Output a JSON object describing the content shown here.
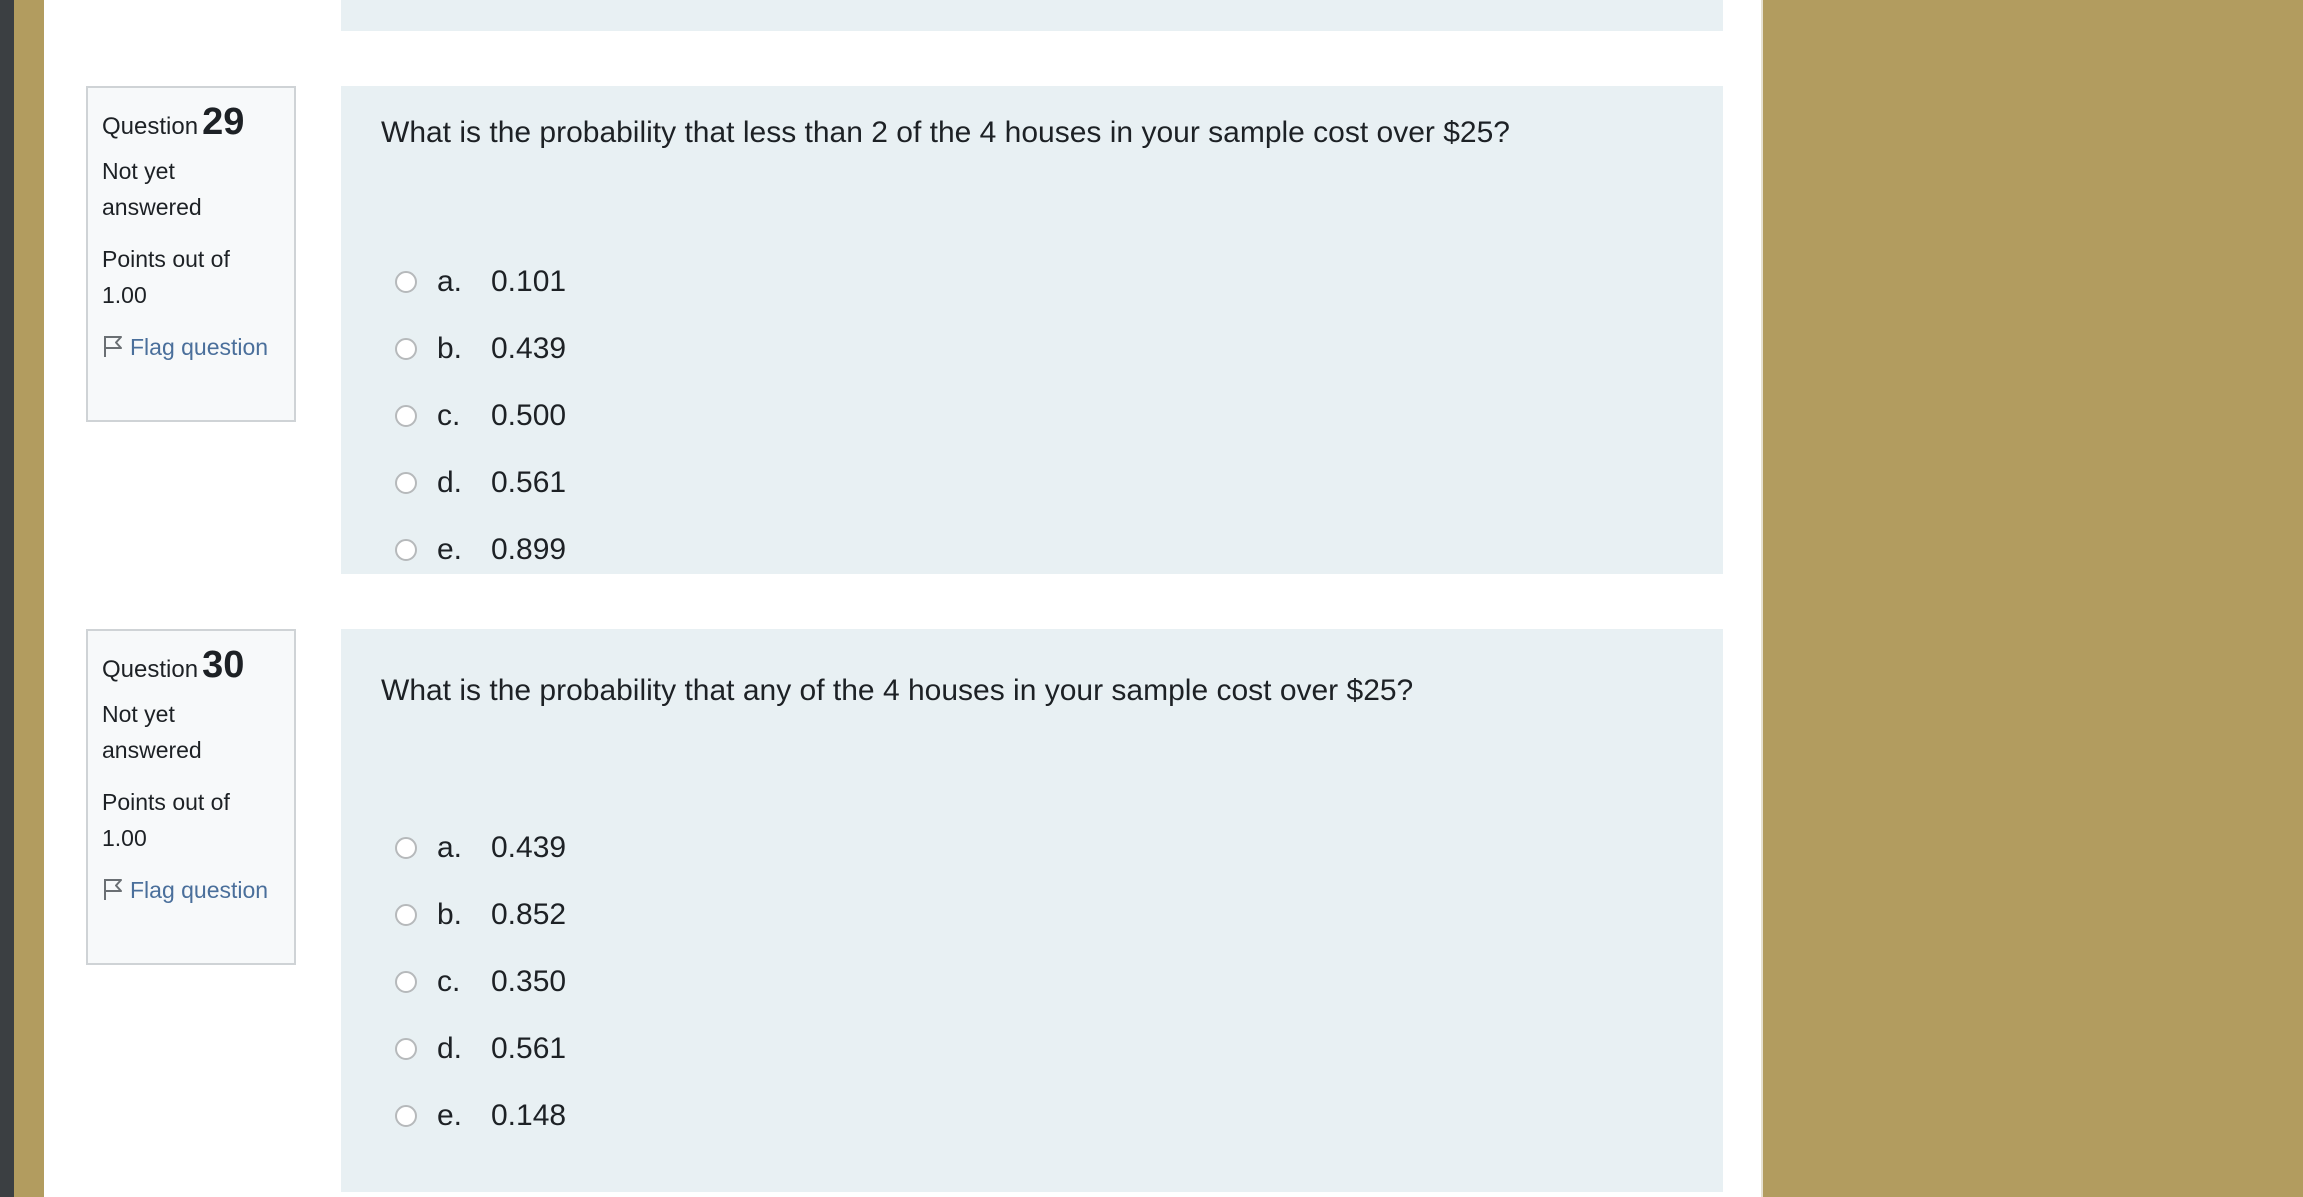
{
  "questions": [
    {
      "prefix": "Question",
      "number": "29",
      "state": "Not yet answered",
      "grade": "Points out of 1.00",
      "flag": "Flag question",
      "text": "What is the probability that less than 2 of the 4 houses in your sample cost over $25?",
      "answers": [
        {
          "letter": "a.",
          "value": "0.101"
        },
        {
          "letter": "b.",
          "value": "0.439"
        },
        {
          "letter": "c.",
          "value": "0.500"
        },
        {
          "letter": "d.",
          "value": "0.561"
        },
        {
          "letter": "e.",
          "value": "0.899"
        }
      ]
    },
    {
      "prefix": "Question",
      "number": "30",
      "state": "Not yet answered",
      "grade": "Points out of 1.00",
      "flag": "Flag question",
      "text": "What is the probability that any of the 4 houses in your sample cost over $25?",
      "answers": [
        {
          "letter": "a.",
          "value": "0.439"
        },
        {
          "letter": "b.",
          "value": "0.852"
        },
        {
          "letter": "c.",
          "value": "0.350"
        },
        {
          "letter": "d.",
          "value": "0.561"
        },
        {
          "letter": "e.",
          "value": "0.148"
        }
      ]
    }
  ],
  "icons": {
    "flag": "flag-icon"
  },
  "colors": {
    "background": "#b29c5f",
    "content_bg": "#e8f0f3",
    "link": "#4a6f9b"
  }
}
